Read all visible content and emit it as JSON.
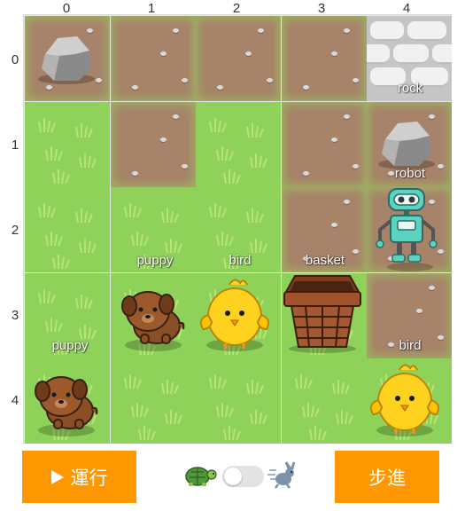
{
  "grid": {
    "column_labels": [
      "0",
      "1",
      "2",
      "3",
      "4"
    ],
    "row_labels": [
      "0",
      "1",
      "2",
      "3",
      "4"
    ],
    "terrain": [
      [
        "dirt",
        "dirt",
        "dirt",
        "dirt",
        "wall"
      ],
      [
        "grass",
        "dirt",
        "grass",
        "dirt",
        "dirt"
      ],
      [
        "grass",
        "grass",
        "grass",
        "dirt",
        "dirt"
      ],
      [
        "grass",
        "grass",
        "grass",
        "grass",
        "dirt"
      ],
      [
        "grass",
        "grass",
        "grass",
        "grass",
        "grass"
      ]
    ],
    "labels": {
      "rock": "rock",
      "robot": "robot",
      "puppy_a": "puppy",
      "bird_a": "bird",
      "basket": "basket",
      "puppy_b": "puppy",
      "bird_b": "bird"
    },
    "objects": [
      {
        "icon": "rock-icon",
        "row": 0,
        "col": 0
      },
      {
        "icon": "rock-icon",
        "row": 1,
        "col": 4
      },
      {
        "icon": "robot-icon",
        "row": 2,
        "col": 4
      },
      {
        "icon": "puppy-icon",
        "row": 3,
        "col": 1
      },
      {
        "icon": "bird-icon",
        "row": 3,
        "col": 2
      },
      {
        "icon": "basket-icon",
        "row": 3,
        "col": 3
      },
      {
        "icon": "puppy-icon",
        "row": 4,
        "col": 0
      },
      {
        "icon": "bird-icon",
        "row": 4,
        "col": 4
      }
    ]
  },
  "controls": {
    "run_label": "運行",
    "step_label": "步進",
    "slow_icon": "turtle-icon",
    "fast_icon": "rabbit-icon",
    "speed_fast": false
  },
  "colors": {
    "button": "#ff9800",
    "grass": "#8fd25a",
    "dirt": "#a7836a",
    "wall": "#c5c5c5",
    "robot": "#5ad4c0"
  }
}
